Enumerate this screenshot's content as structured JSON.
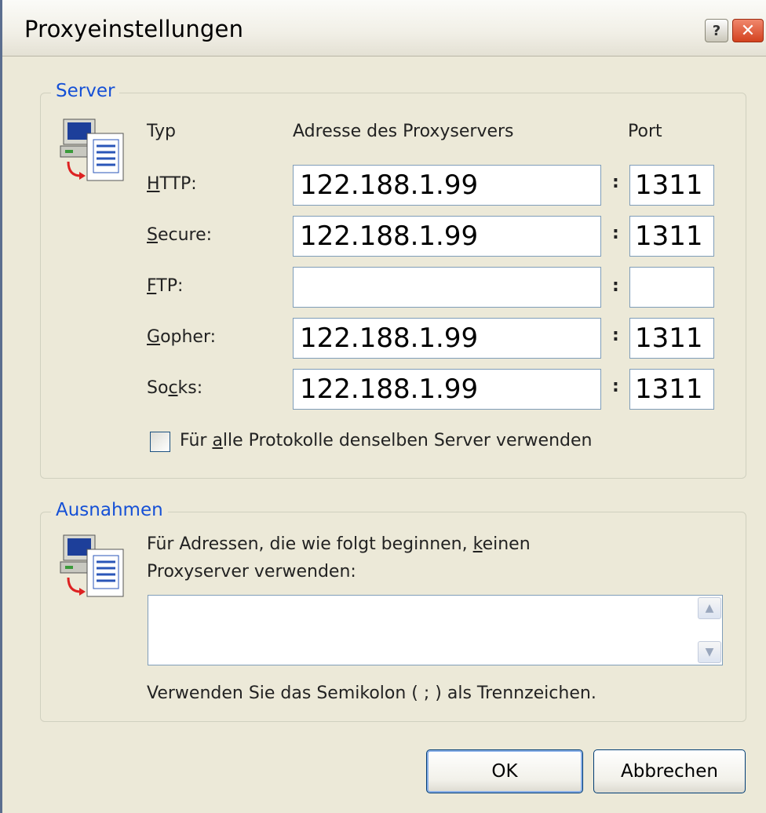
{
  "window": {
    "title": "Proxyeinstellungen",
    "help_glyph": "?",
    "close_glyph": "✕"
  },
  "server": {
    "legend": "Server",
    "col_type": "Typ",
    "col_address": "Adresse des Proxyservers",
    "col_port": "Port",
    "rows": [
      {
        "label_key": "H",
        "label_rest": "TTP:",
        "address": "122.188.1.99",
        "port": "1311"
      },
      {
        "label_key": "S",
        "label_rest": "ecure:",
        "address": "122.188.1.99",
        "port": "1311"
      },
      {
        "label_key": "F",
        "label_rest": "TP:",
        "address": "",
        "port": ""
      },
      {
        "label_key": "G",
        "label_rest": "opher:",
        "address": "122.188.1.99",
        "port": "1311"
      },
      {
        "label_pre": "So",
        "label_key": "c",
        "label_rest": "ks:",
        "address": "122.188.1.99",
        "port": "1311"
      }
    ],
    "colon": ":",
    "same_server_pre": "Für ",
    "same_server_key": "a",
    "same_server_rest": "lle Protokolle denselben Server verwenden",
    "same_server_checked": false
  },
  "exceptions": {
    "legend": "Ausnahmen",
    "desc_line1_pre": "Für Adressen, die wie folgt beginnen, ",
    "desc_line1_key": "k",
    "desc_line1_rest": "einen",
    "desc_line2": "Proxyserver verwenden:",
    "value": "",
    "hint": "Verwenden Sie das Semikolon ( ; ) als Trennzeichen."
  },
  "buttons": {
    "ok": "OK",
    "cancel": "Abbrechen"
  },
  "icons": {
    "server_icon": "network-computer-icon",
    "exceptions_icon": "network-computer-icon"
  }
}
